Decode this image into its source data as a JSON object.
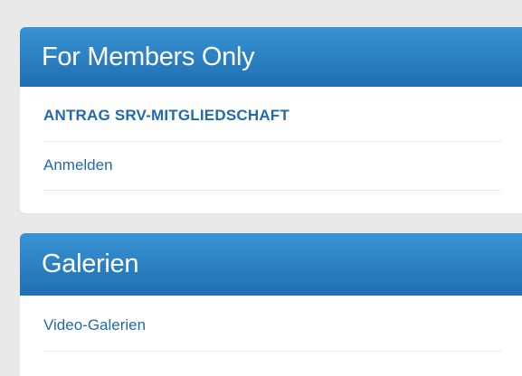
{
  "members_widget": {
    "title": "For Members Only",
    "links": [
      {
        "label": "ANTRAG SRV-MITGLIEDSCHAFT"
      },
      {
        "label": "Anmelden"
      }
    ]
  },
  "galleries_widget": {
    "title": "Galerien",
    "links": [
      {
        "label": "Video-Galerien"
      }
    ]
  },
  "colors": {
    "header_blue": "#2a7fc1",
    "link_blue": "#236aab",
    "page_background": "#e9e9e9"
  }
}
